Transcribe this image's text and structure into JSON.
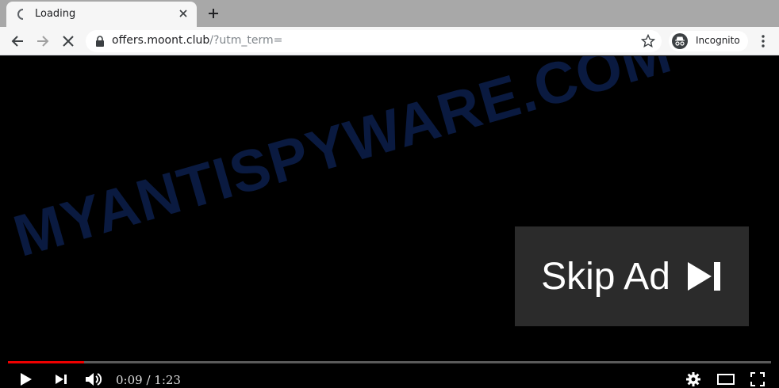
{
  "browser": {
    "tab": {
      "title": "Loading"
    },
    "url": {
      "domain": "offers.moont.club",
      "path": "/?utm_term="
    },
    "profile": {
      "label": "Incognito"
    }
  },
  "video": {
    "watermark": "MYANTISPYWARE.COM",
    "skip_ad_label": "Skip Ad",
    "time_display": "0:09 / 1:23",
    "progress_fraction": 0.1,
    "accent_color": "#ee0000"
  }
}
